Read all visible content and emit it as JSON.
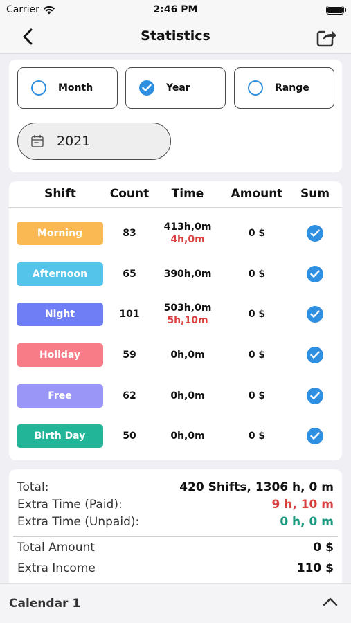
{
  "status_bar": {
    "carrier": "Carrier",
    "time": "2:46 PM"
  },
  "nav": {
    "title": "Statistics",
    "back_icon": "chevron-left-icon",
    "share_icon": "share-icon"
  },
  "period": {
    "options": [
      {
        "label": "Month",
        "selected": false
      },
      {
        "label": "Year",
        "selected": true
      },
      {
        "label": "Range",
        "selected": false
      }
    ],
    "year": "2021",
    "accent": "#2f8fe0"
  },
  "table": {
    "headers": {
      "shift": "Shift",
      "count": "Count",
      "time": "Time",
      "amount": "Amount",
      "sum": "Sum"
    },
    "rows": [
      {
        "shift": "Morning",
        "color": "#fbb953",
        "count": "83",
        "time": "413h,0m",
        "extra": "4h,0m",
        "amount": "0 $",
        "sum": true
      },
      {
        "shift": "Afternoon",
        "color": "#55c4ea",
        "count": "65",
        "time": "390h,0m",
        "extra": "",
        "amount": "0 $",
        "sum": true
      },
      {
        "shift": "Night",
        "color": "#6f7ef5",
        "count": "101",
        "time": "503h,0m",
        "extra": "5h,10m",
        "amount": "0 $",
        "sum": true
      },
      {
        "shift": "Holiday",
        "color": "#f77c87",
        "count": "59",
        "time": "0h,0m",
        "extra": "",
        "amount": "0 $",
        "sum": true
      },
      {
        "shift": "Free",
        "color": "#9a96f8",
        "count": "62",
        "time": "0h,0m",
        "extra": "",
        "amount": "0 $",
        "sum": true
      },
      {
        "shift": "Birth Day",
        "color": "#22b597",
        "count": "50",
        "time": "0h,0m",
        "extra": "",
        "amount": "0 $",
        "sum": true
      }
    ]
  },
  "totals": {
    "total_label": "Total:",
    "total_value": "420 Shifts, 1306 h, 0 m",
    "paid_label": "Extra Time (Paid):",
    "paid_value": "9 h, 10 m",
    "unpaid_label": "Extra Time (Unpaid):",
    "unpaid_value": "0 h, 0 m",
    "amount_label": "Total Amount",
    "amount_value": "0 $",
    "income_label": "Extra Income",
    "income_value": "110 $"
  },
  "bottom": {
    "calendar_name": "Calendar 1",
    "chevron_icon": "chevron-up-icon"
  },
  "colors": {
    "extra_red": "#d94141",
    "unpaid_teal": "#1c9a80",
    "accent_blue": "#2f8fe0"
  }
}
